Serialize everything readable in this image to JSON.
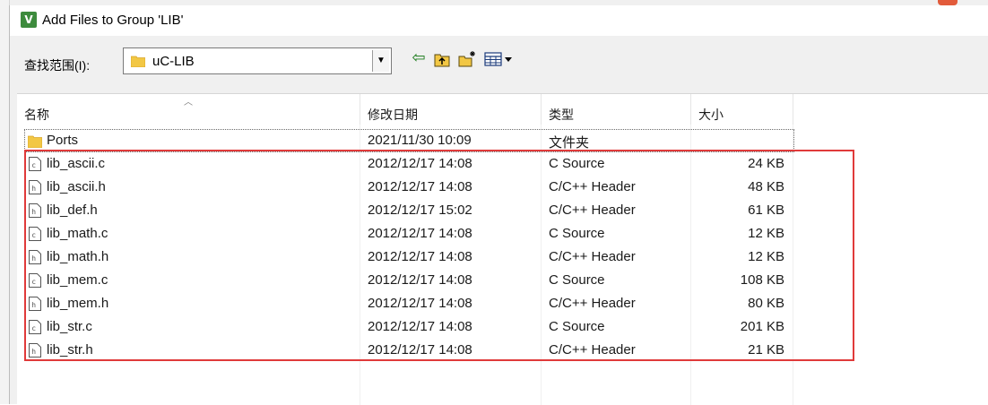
{
  "dialog": {
    "title": "Add Files to Group 'LIB'",
    "icon_name": "keil-uvision-icon"
  },
  "lookin": {
    "label": "查找范围(I):",
    "value": "uC-LIB"
  },
  "toolbar": {
    "back_icon": "back-arrow-icon",
    "up_icon": "up-folder-icon",
    "new_folder_icon": "new-folder-icon",
    "view_icon": "view-menu-icon"
  },
  "columns": [
    "名称",
    "修改日期",
    "类型",
    "大小"
  ],
  "files": [
    {
      "name": "Ports",
      "date": "2021/11/30 10:09",
      "type": "文件夹",
      "size": "",
      "icon": "folder-icon"
    },
    {
      "name": "lib_ascii.c",
      "date": "2012/12/17 14:08",
      "type": "C Source",
      "size": "24 KB",
      "icon": "c-file-icon"
    },
    {
      "name": "lib_ascii.h",
      "date": "2012/12/17 14:08",
      "type": "C/C++ Header",
      "size": "48 KB",
      "icon": "h-file-icon"
    },
    {
      "name": "lib_def.h",
      "date": "2012/12/17 15:02",
      "type": "C/C++ Header",
      "size": "61 KB",
      "icon": "h-file-icon"
    },
    {
      "name": "lib_math.c",
      "date": "2012/12/17 14:08",
      "type": "C Source",
      "size": "12 KB",
      "icon": "c-file-icon"
    },
    {
      "name": "lib_math.h",
      "date": "2012/12/17 14:08",
      "type": "C/C++ Header",
      "size": "12 KB",
      "icon": "h-file-icon"
    },
    {
      "name": "lib_mem.c",
      "date": "2012/12/17 14:08",
      "type": "C Source",
      "size": "108 KB",
      "icon": "c-file-icon"
    },
    {
      "name": "lib_mem.h",
      "date": "2012/12/17 14:08",
      "type": "C/C++ Header",
      "size": "80 KB",
      "icon": "h-file-icon"
    },
    {
      "name": "lib_str.c",
      "date": "2012/12/17 14:08",
      "type": "C Source",
      "size": "201 KB",
      "icon": "c-file-icon"
    },
    {
      "name": "lib_str.h",
      "date": "2012/12/17 14:08",
      "type": "C/C++ Header",
      "size": "21 KB",
      "icon": "h-file-icon"
    }
  ],
  "colors": {
    "highlight": "#e03a3a",
    "folder": "#f2c744",
    "back_arrow": "#1a7a1a"
  }
}
